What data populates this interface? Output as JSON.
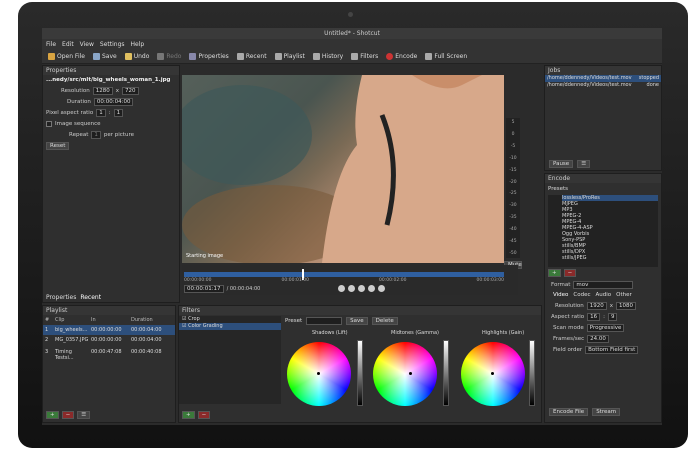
{
  "window": {
    "title": "Untitled* - Shotcut"
  },
  "menu": [
    "File",
    "Edit",
    "View",
    "Settings",
    "Help"
  ],
  "toolbar": [
    {
      "label": "Open File",
      "icon": "folder-icon",
      "color": "#d9a441"
    },
    {
      "label": "Save",
      "icon": "save-icon",
      "color": "#8aa6c8"
    },
    {
      "label": "Undo",
      "icon": "undo-icon",
      "color": "#e0c060"
    },
    {
      "label": "Redo",
      "icon": "redo-icon",
      "color": "#777777"
    },
    {
      "label": "Properties",
      "icon": "properties-icon",
      "color": "#8888aa"
    },
    {
      "label": "Recent",
      "icon": "recent-icon",
      "color": "#aaaaaa"
    },
    {
      "label": "Playlist",
      "icon": "playlist-icon",
      "color": "#aaaaaa"
    },
    {
      "label": "History",
      "icon": "history-icon",
      "color": "#aaaaaa"
    },
    {
      "label": "Filters",
      "icon": "filters-icon",
      "color": "#aaaaaa"
    },
    {
      "label": "Encode",
      "icon": "encode-icon",
      "color": "#cc3333"
    },
    {
      "label": "Full Screen",
      "icon": "fullscreen-icon",
      "color": "#aaaaaa"
    }
  ],
  "properties": {
    "title": "Properties",
    "file": "...nedy/src/mlt/big_wheels_woman_1.jpg",
    "resolution_label": "Resolution",
    "res_w": "1280",
    "res_x": "x",
    "res_h": "720",
    "duration_label": "Duration",
    "duration": "00:00:04:00",
    "par_label": "Pixel aspect ratio",
    "par_a": "1",
    "par_sep": ":",
    "par_b": "1",
    "image_seq_label": "Image sequence",
    "repeat_label": "Repeat",
    "repeat_value": "1",
    "per_picture": "per picture",
    "reset": "Reset",
    "tabs": [
      "Properties",
      "Recent"
    ]
  },
  "preview": {
    "caption": "Starting image",
    "meter": [
      "5",
      "0",
      "-5",
      "-10",
      "-15",
      "-20",
      "-25",
      "-30",
      "-35",
      "-40",
      "-45",
      "-50"
    ],
    "mute": "Mute"
  },
  "timeline": {
    "timecode": "00:00:01:17",
    "total": "/ 00:00:04:00",
    "ticks": [
      "00:00:00:00",
      "00:00:01:00",
      "00:00:02:00",
      "00:00:03:00"
    ],
    "position": 0.37
  },
  "jobs": {
    "title": "Jobs",
    "items": [
      {
        "path": "/home/ddennedy/Videos/test.mov",
        "status": "stopped"
      },
      {
        "path": "/home/ddennedy/Videos/test.mov",
        "status": "done"
      }
    ],
    "pause": "Pause",
    "menu": "☰"
  },
  "encode": {
    "title": "Encode",
    "presets_label": "Presets",
    "presets": [
      "lossless/ProRes",
      "MJPEG",
      "MP3",
      "MPEG-2",
      "MPEG-4",
      "MPEG-4-ASP",
      "Ogg Vorbis",
      "Sony-PSP",
      "stills/BMP",
      "stills/DPX",
      "stills/JPEG"
    ],
    "format_label": "Format",
    "format": "mov",
    "tabs": [
      "Video",
      "Codec",
      "Audio",
      "Other"
    ],
    "resolution_label": "Resolution",
    "res_w": "1920",
    "res_x": "x",
    "res_h": "1080",
    "aspect_label": "Aspect ratio",
    "aspect_a": "16",
    "aspect_sep": ":",
    "aspect_b": "9",
    "scan_label": "Scan mode",
    "scan": "Progressive",
    "fps_label": "Frames/sec",
    "fps": "24.00",
    "field_label": "Field order",
    "field": "Bottom Field first",
    "encode_file": "Encode File",
    "stream": "Stream"
  },
  "playlist": {
    "title": "Playlist",
    "columns": [
      "#",
      "Clip",
      "In",
      "Duration"
    ],
    "rows": [
      {
        "num": "1",
        "clip": "big_wheels...",
        "in": "00:00:00:00",
        "dur": "00:00:04:00"
      },
      {
        "num": "2",
        "clip": "MG_0357.JPG",
        "in": "00:00:00:00",
        "dur": "00:00:04:00"
      },
      {
        "num": "3",
        "clip": "Timing Testsi...",
        "in": "00:00:47:08",
        "dur": "00:00:40:08"
      }
    ]
  },
  "filters": {
    "title": "Filters",
    "items": [
      "Crop",
      "Color Grading"
    ],
    "preset_label": "Preset",
    "save": "Save",
    "delete": "Delete",
    "wheels": [
      {
        "label": "Shadows (Lift)"
      },
      {
        "label": "Midtones (Gamma)"
      },
      {
        "label": "Highlights (Gain)"
      }
    ]
  }
}
